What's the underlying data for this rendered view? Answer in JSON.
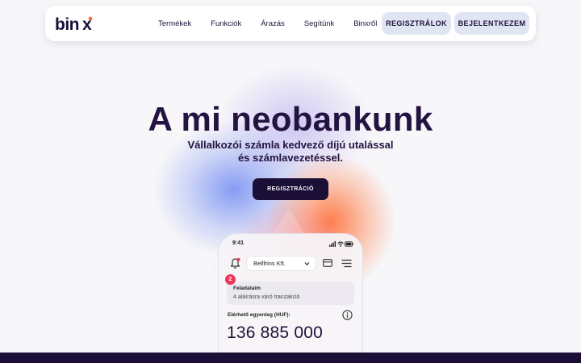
{
  "brand": {
    "name": "binx",
    "accent": "#f26b2c",
    "dark": "#1b0f38"
  },
  "nav": {
    "links": [
      "Termékek",
      "Funkciók",
      "Árazás",
      "Segítünk",
      "Binxről"
    ],
    "register_label": "REGISZTRÁLOK",
    "login_label": "BEJELENTKEZEM"
  },
  "hero": {
    "title": "A mi neobankunk",
    "subtitle_line1": "Vállalkozói számla kedvező díjú utalással",
    "subtitle_line2": "és számlavezetéssel.",
    "cta_label": "REGISZTRÁCIÓ"
  },
  "phone": {
    "time": "9:41",
    "company_select": "Bellfrins Kft.",
    "tasks_count": "2",
    "tasks_title": "Feladataim",
    "tasks_desc": "4 aláírásra váró tranzakció",
    "balance_label": "Elérhető egyenleg (HUF):",
    "balance_amount": "136 885 000",
    "icons": [
      "bell-icon",
      "chevron-down-icon",
      "card-icon",
      "menu-icon",
      "info-icon",
      "signal-icon",
      "wifi-icon",
      "battery-icon"
    ]
  }
}
